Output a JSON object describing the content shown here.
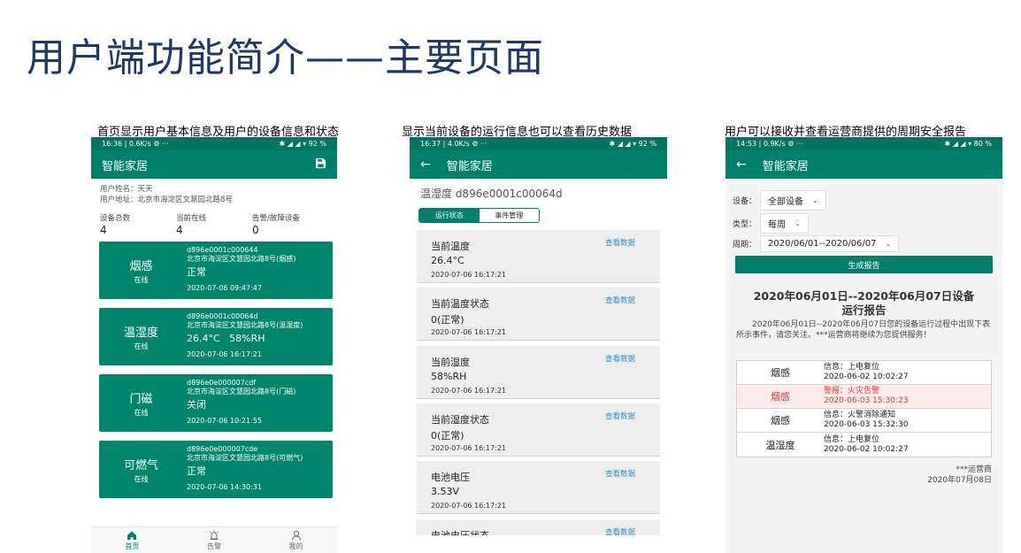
{
  "slide_title": "用户端功能简介——主要页面",
  "captions": [
    "首页显示用户基本信息及用户的设备信息和状态",
    "显示当前设备的运行信息也可以查看历史数据",
    "用户可以接收并查看运营商提供的周期安全报告"
  ],
  "phone1": {
    "status_time": "16:36 | 0.6K/s ⚙ ···",
    "status_right": "✱ ◢ ◢ ▾ 92 %",
    "app_title": "智能家居",
    "user_name_line": "用户姓名：天天",
    "user_addr_line": "用户地址：北京市海淀区文慧园北路8号",
    "stats": [
      {
        "label": "设备总数",
        "value": "4"
      },
      {
        "label": "当前在线",
        "value": "4"
      },
      {
        "label": "告警/故障设备",
        "value": "0"
      }
    ],
    "devices": [
      {
        "name": "烟感",
        "online": "在线",
        "id": "d896e0001c000644",
        "addr": "北京市海淀区文慧园北路8号(烟感)",
        "status": "正常",
        "time": "2020-07-06 09:47:47"
      },
      {
        "name": "温湿度",
        "online": "在线",
        "id": "d896e0001c00064d",
        "addr": "北京市海淀区文慧园北路8号(温湿度)",
        "status": "26.4°C   58%RH",
        "time": "2020-07-06 16:17:21"
      },
      {
        "name": "门磁",
        "online": "在线",
        "id": "d896e0e000007cdf",
        "addr": "北京市海淀区文慧园北路8号(门磁)",
        "status": "关闭",
        "time": "2020-07-06 10:21:55"
      },
      {
        "name": "可燃气",
        "online": "在线",
        "id": "d896e0e000007cde",
        "addr": "北京市海淀区文慧园北路8号(可燃气)",
        "status": "正常",
        "time": "2020-07-06 14:30:31"
      }
    ],
    "tabs": [
      "首页",
      "告警",
      "我的"
    ]
  },
  "phone2": {
    "status_time": "16:37 | 4.0K/s ⚙ ···",
    "status_right": "✱ ◢ ◢ ▾ 92 %",
    "app_title": "智能家居",
    "sensor_title": "温湿度  d896e0001c00064d",
    "seg_on": "运行状态",
    "seg_off": "事件管理",
    "cards": [
      {
        "label": "当前温度",
        "link": "查看数据",
        "value": "26.4°C",
        "time": "2020-07-06 16:17:21"
      },
      {
        "label": "当前温度状态",
        "link": "查看数据",
        "value": "0(正常)",
        "time": "2020-07-06 16:17:21"
      },
      {
        "label": "当前湿度",
        "link": "查看数据",
        "value": "58%RH",
        "time": "2020-07-06 16:17:21"
      },
      {
        "label": "当前湿度状态",
        "link": "查看数据",
        "value": "0(正常)",
        "time": "2020-07-06 16:17:21"
      },
      {
        "label": "电池电压",
        "link": "查看数据",
        "value": "3.53V",
        "time": "2020-07-06 16:17:21"
      },
      {
        "label": "电池电压状态",
        "link": "查看数据",
        "value": "",
        "time": ""
      }
    ]
  },
  "phone3": {
    "status_time": "14:53 | 0.9K/s ⚙ ···",
    "status_right": "✱ ◢ ◢ ▾ 80 %",
    "app_title": "智能家居",
    "device_label": "设备：",
    "device_value": "全部设备",
    "type_label": "类型：",
    "type_value": "每周",
    "period_label": "周期：",
    "period_value": "2020/06/01--2020/06/07",
    "generate_button": "生成报告",
    "report_title_l1": "2020年06月01日--2020年06月07日设备",
    "report_title_l2": "运行报告",
    "report_intro": "2020年06月01日--2020年06月07日您的设备运行过程中出现下表所示事件，请您关注。***运营商将继续为您提供服务！",
    "events": [
      {
        "device": "烟感",
        "info": "信息：上电复位",
        "time": "2020-06-02 10:02:27",
        "alarm": false
      },
      {
        "device": "烟感",
        "info": "警报：火灾告警",
        "time": "2020-06-03 15:30:23",
        "alarm": true
      },
      {
        "device": "烟感",
        "info": "信息：火警消除通知",
        "time": "2020-06-03 15:32:30",
        "alarm": false
      },
      {
        "device": "温湿度",
        "info": "信息：上电复位",
        "time": "2020-06-02 10:02:27",
        "alarm": false
      }
    ],
    "sign_company": "***运营商",
    "sign_date": "2020年07月08日"
  },
  "colors": {
    "primary": "#00806a",
    "title": "#1f3864",
    "link": "#2e8fd0",
    "alarm": "#d9383a"
  }
}
